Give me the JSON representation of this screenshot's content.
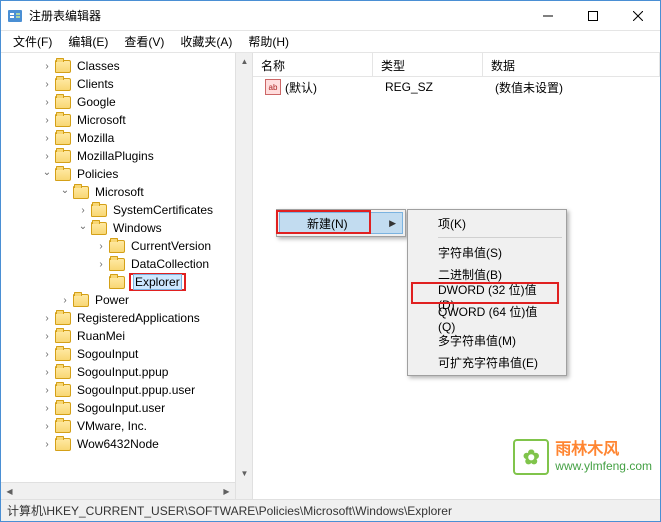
{
  "titlebar": {
    "title": "注册表编辑器"
  },
  "menubar": [
    "文件(F)",
    "编辑(E)",
    "查看(V)",
    "收藏夹(A)",
    "帮助(H)"
  ],
  "tree": [
    {
      "indent": 2,
      "toggle": ">",
      "label": "Classes"
    },
    {
      "indent": 2,
      "toggle": ">",
      "label": "Clients"
    },
    {
      "indent": 2,
      "toggle": ">",
      "label": "Google"
    },
    {
      "indent": 2,
      "toggle": ">",
      "label": "Microsoft"
    },
    {
      "indent": 2,
      "toggle": ">",
      "label": "Mozilla"
    },
    {
      "indent": 2,
      "toggle": ">",
      "label": "MozillaPlugins"
    },
    {
      "indent": 2,
      "toggle": "v",
      "label": "Policies"
    },
    {
      "indent": 3,
      "toggle": "v",
      "label": "Microsoft"
    },
    {
      "indent": 4,
      "toggle": ">",
      "label": "SystemCertificates"
    },
    {
      "indent": 4,
      "toggle": "v",
      "label": "Windows"
    },
    {
      "indent": 5,
      "toggle": ">",
      "label": "CurrentVersion"
    },
    {
      "indent": 5,
      "toggle": ">",
      "label": "DataCollection"
    },
    {
      "indent": 5,
      "toggle": "",
      "label": "Explorer",
      "selected": true,
      "highlight": true
    },
    {
      "indent": 3,
      "toggle": ">",
      "label": "Power"
    },
    {
      "indent": 2,
      "toggle": ">",
      "label": "RegisteredApplications"
    },
    {
      "indent": 2,
      "toggle": ">",
      "label": "RuanMei"
    },
    {
      "indent": 2,
      "toggle": ">",
      "label": "SogouInput"
    },
    {
      "indent": 2,
      "toggle": ">",
      "label": "SogouInput.ppup"
    },
    {
      "indent": 2,
      "toggle": ">",
      "label": "SogouInput.ppup.user"
    },
    {
      "indent": 2,
      "toggle": ">",
      "label": "SogouInput.user"
    },
    {
      "indent": 2,
      "toggle": ">",
      "label": "VMware, Inc."
    },
    {
      "indent": 2,
      "toggle": ">",
      "label": "Wow6432Node"
    }
  ],
  "list": {
    "headers": [
      "名称",
      "类型",
      "数据"
    ],
    "header_widths": [
      120,
      110,
      140
    ],
    "rows": [
      {
        "icon": "ab",
        "name": "(默认)",
        "type": "REG_SZ",
        "data": "(数值未设置)"
      }
    ]
  },
  "context1": {
    "label": "新建(N)",
    "has_arrow": true
  },
  "context2": [
    {
      "label": "项(K)"
    },
    {
      "sep": true
    },
    {
      "label": "字符串值(S)"
    },
    {
      "label": "二进制值(B)"
    },
    {
      "label": "DWORD (32 位)值(D)",
      "highlight": true
    },
    {
      "label": "QWORD (64 位)值(Q)"
    },
    {
      "label": "多字符串值(M)"
    },
    {
      "label": "可扩充字符串值(E)"
    }
  ],
  "statusbar": "计算机\\HKEY_CURRENT_USER\\SOFTWARE\\Policies\\Microsoft\\Windows\\Explorer",
  "watermark": {
    "cn": "雨林木风",
    "url": "www.ylmfeng.com"
  }
}
